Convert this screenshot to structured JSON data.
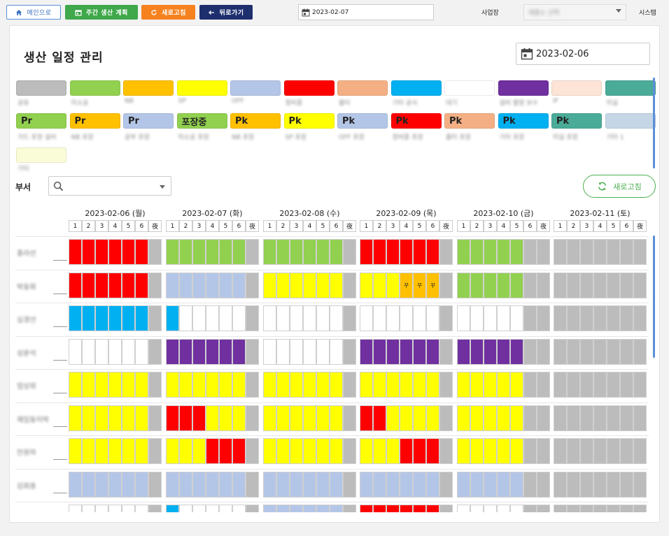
{
  "toolbar": {
    "main_label": "메인으로",
    "week_label": "주간 생산 계획",
    "refresh_label": "새로고침",
    "back_label": "뒤로가기",
    "date": "2023-02-07",
    "site_label": "사업장",
    "site_value": "제품소 선택",
    "system_label": "시스템"
  },
  "page": {
    "title": "생산 일정 관리",
    "date": "2023-02-06"
  },
  "legend": {
    "row1": [
      {
        "color": "#bcbcbc",
        "label": "공휴"
      },
      {
        "color": "#92d050",
        "label": "미소공"
      },
      {
        "color": "#ffc000",
        "label": "NB"
      },
      {
        "color": "#ffff00",
        "label": "SP"
      },
      {
        "color": "#b4c6e7",
        "label": "OFF"
      },
      {
        "color": "#ff0000",
        "label": "정비중"
      },
      {
        "color": "#f4b084",
        "label": "출타"
      },
      {
        "color": "#00b0f0",
        "label": "기타 공사"
      },
      {
        "color": "#ffffff",
        "label": "대기"
      },
      {
        "color": "#7030a0",
        "label": "설비 불량 보수"
      },
      {
        "color": "#fce4d6",
        "label": "IF"
      },
      {
        "color": "#4aab98",
        "label": "미실"
      }
    ],
    "row2": [
      {
        "color": "#92d050",
        "text": "Pr",
        "label": "가드 포장 설비"
      },
      {
        "color": "#ffc000",
        "text": "Pr",
        "label": "NB 포장"
      },
      {
        "color": "#b4c6e7",
        "text": "Pr",
        "label": "공부 포장"
      },
      {
        "color": "#92d050",
        "text": "포장중",
        "label": "미소공 포장"
      },
      {
        "color": "#ffc000",
        "text": "Pk",
        "label": "NB 포장"
      },
      {
        "color": "#ffff00",
        "text": "Pk",
        "label": "SP 포장"
      },
      {
        "color": "#b4c6e7",
        "text": "Pk",
        "label": "OFF 포장"
      },
      {
        "color": "#ff0000",
        "text": "Pk",
        "label": "정비중 포장"
      },
      {
        "color": "#f4b084",
        "text": "Pk",
        "label": "출타 포장"
      },
      {
        "color": "#00b0f0",
        "text": "Pk",
        "label": "기타 포장"
      },
      {
        "color": "#4aab98",
        "text": "Pk",
        "label": "미실 포장"
      },
      {
        "color": "#c5d6e6",
        "text": "",
        "label": "기타 1"
      }
    ],
    "row3": [
      {
        "color": "#fafcd8",
        "text": "",
        "label": "기타"
      }
    ]
  },
  "filter": {
    "dept_label": "부서",
    "refresh_label": "새로고침"
  },
  "schedule": {
    "days": [
      "2023-02-06 (월)",
      "2023-02-07 (화)",
      "2023-02-08 (수)",
      "2023-02-09 (목)",
      "2023-02-10 (금)",
      "2023-02-11 (토)"
    ],
    "slots": [
      "1",
      "2",
      "3",
      "4",
      "5",
      "6",
      "夜"
    ],
    "palette": {
      "R": "#ff0000",
      "G": "#92d050",
      "B": "#b4c6e7",
      "Y": "#ffff00",
      "C": "#00b0f0",
      "P": "#7030a0",
      "W": "#ffffff",
      "S": "#bcbcbc",
      "O": "#ffc000"
    },
    "rows": [
      {
        "name": "홍라선",
        "cells": [
          "RRRRRRS",
          "GGGGGGS",
          "GGGGGGS",
          "RRRRRRS",
          "GGGGGSS",
          "SSSSSSS"
        ]
      },
      {
        "name": "박동화",
        "cells": [
          "RRRRRRS",
          "BBBBBBS",
          "YYYYYYS",
          "YYYOOOS",
          "GGGGGSS",
          "SSSSSSS"
        ]
      },
      {
        "name": "심경선",
        "cells": [
          "CCCCCCS",
          "CWWWWWS",
          "WWWWWWS",
          "WWWWWWS",
          "WWWWWSS",
          "SSSSSSS"
        ]
      },
      {
        "name": "성운석",
        "cells": [
          "WWWWWWS",
          "PPPPPPS",
          "WWWWWWS",
          "PPPPPPS",
          "PPPPPSS",
          "SSSSSSS"
        ]
      },
      {
        "name": "엄상희",
        "cells": [
          "YYYYYYS",
          "YYYYYYS",
          "YYYYYYS",
          "YYYYYYS",
          "YYYYYSS",
          "SSSSSSS"
        ]
      },
      {
        "name": "재임동이박",
        "cells": [
          "YYYYYYS",
          "RRRYYYS",
          "YYYYYYS",
          "RRYYYYS",
          "YYYYYSS",
          "SSSSSSS"
        ]
      },
      {
        "name": "안원하",
        "cells": [
          "YYYYYYS",
          "YYYRRRS",
          "YYYYYYS",
          "YYYRRRS",
          "YYYYYSS",
          "SSSSSSS"
        ]
      },
      {
        "name": "김회용",
        "cells": [
          "BBBBBBS",
          "BBBBBBS",
          "BBBBBBS",
          "BBBBBBS",
          "BBBBBSS",
          "SSSSSSS"
        ]
      },
      {
        "name": "",
        "cells": [
          "WWWWWWS",
          "CWWWWWS",
          "BBBBBBS",
          "RRRRRRS",
          "WWWWWSS",
          "SSSSSSS"
        ]
      }
    ],
    "marks": [
      {
        "row": 1,
        "day": 3,
        "slot": 3,
        "text": "꾸"
      },
      {
        "row": 1,
        "day": 3,
        "slot": 4,
        "text": "꾸"
      },
      {
        "row": 1,
        "day": 3,
        "slot": 5,
        "text": "꾸"
      }
    ]
  }
}
